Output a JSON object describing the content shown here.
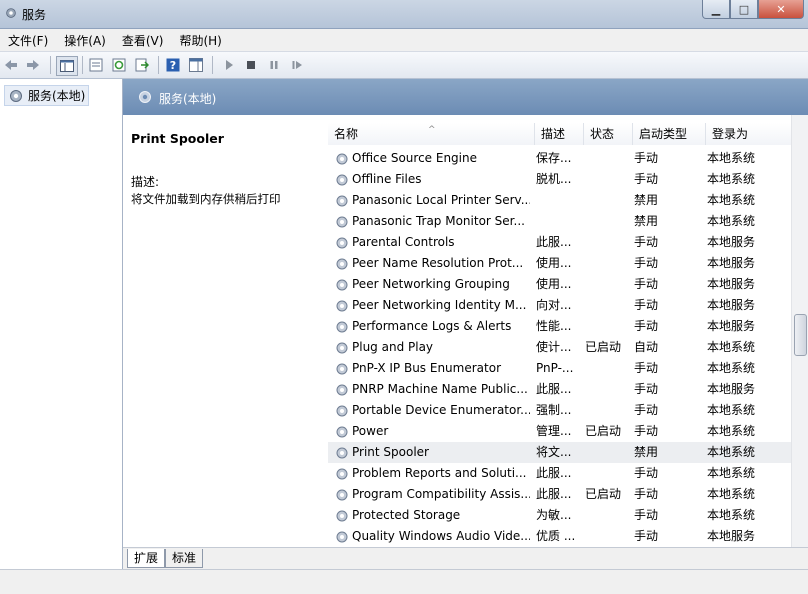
{
  "window": {
    "title": "服务"
  },
  "menu": [
    "文件(F)",
    "操作(A)",
    "查看(V)",
    "帮助(H)"
  ],
  "tree": {
    "item": "服务(本地)"
  },
  "header": {
    "title": "服务(本地)"
  },
  "detail": {
    "service_name": "Print Spooler",
    "desc_label": "描述:",
    "desc_text": "将文件加载到内存供稍后打印"
  },
  "columns": [
    "名称",
    "描述",
    "状态",
    "启动类型",
    "登录为"
  ],
  "services": [
    {
      "name": "Office Source Engine",
      "desc": "保存...",
      "status": "",
      "startup": "手动",
      "logon": "本地系统"
    },
    {
      "name": "Offline Files",
      "desc": "脱机...",
      "status": "",
      "startup": "手动",
      "logon": "本地系统"
    },
    {
      "name": "Panasonic Local Printer Serv...",
      "desc": "",
      "status": "",
      "startup": "禁用",
      "logon": "本地系统"
    },
    {
      "name": "Panasonic Trap Monitor Ser...",
      "desc": "",
      "status": "",
      "startup": "禁用",
      "logon": "本地系统"
    },
    {
      "name": "Parental Controls",
      "desc": "此服...",
      "status": "",
      "startup": "手动",
      "logon": "本地服务"
    },
    {
      "name": "Peer Name Resolution Prot...",
      "desc": "使用...",
      "status": "",
      "startup": "手动",
      "logon": "本地服务"
    },
    {
      "name": "Peer Networking Grouping",
      "desc": "使用...",
      "status": "",
      "startup": "手动",
      "logon": "本地服务"
    },
    {
      "name": "Peer Networking Identity M...",
      "desc": "向对...",
      "status": "",
      "startup": "手动",
      "logon": "本地服务"
    },
    {
      "name": "Performance Logs & Alerts",
      "desc": "性能...",
      "status": "",
      "startup": "手动",
      "logon": "本地服务"
    },
    {
      "name": "Plug and Play",
      "desc": "使计...",
      "status": "已启动",
      "startup": "自动",
      "logon": "本地系统"
    },
    {
      "name": "PnP-X IP Bus Enumerator",
      "desc": "PnP-...",
      "status": "",
      "startup": "手动",
      "logon": "本地系统"
    },
    {
      "name": "PNRP Machine Name Public...",
      "desc": "此服...",
      "status": "",
      "startup": "手动",
      "logon": "本地服务"
    },
    {
      "name": "Portable Device Enumerator...",
      "desc": "强制...",
      "status": "",
      "startup": "手动",
      "logon": "本地系统"
    },
    {
      "name": "Power",
      "desc": "管理...",
      "status": "已启动",
      "startup": "手动",
      "logon": "本地系统"
    },
    {
      "name": "Print Spooler",
      "desc": "将文...",
      "status": "",
      "startup": "禁用",
      "logon": "本地系统"
    },
    {
      "name": "Problem Reports and Soluti...",
      "desc": "此服...",
      "status": "",
      "startup": "手动",
      "logon": "本地系统"
    },
    {
      "name": "Program Compatibility Assis...",
      "desc": "此服...",
      "status": "已启动",
      "startup": "手动",
      "logon": "本地系统"
    },
    {
      "name": "Protected Storage",
      "desc": "为敏...",
      "status": "",
      "startup": "手动",
      "logon": "本地系统"
    },
    {
      "name": "Quality Windows Audio Vide...",
      "desc": "优质 ...",
      "status": "",
      "startup": "手动",
      "logon": "本地服务"
    }
  ],
  "selected_row": 14,
  "tabs": [
    "扩展",
    "标准"
  ]
}
